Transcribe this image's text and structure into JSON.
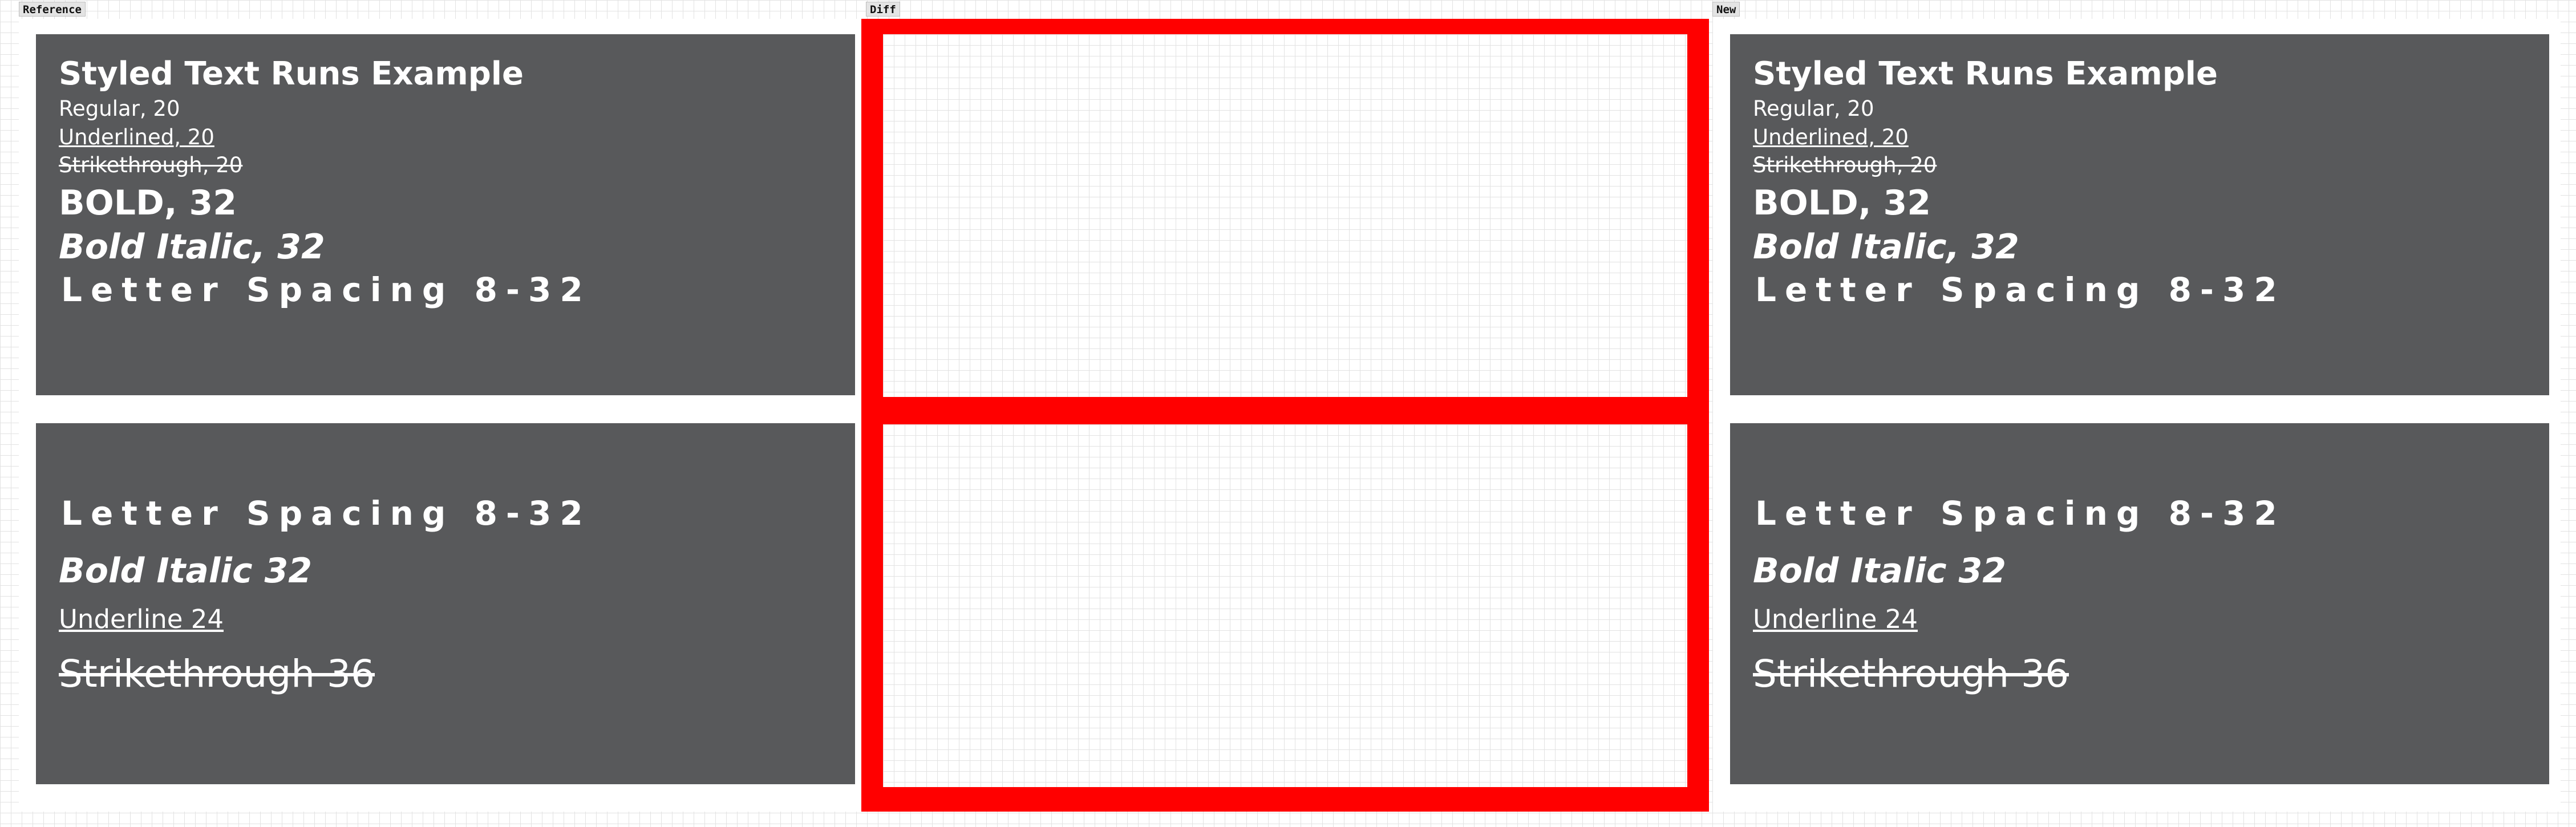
{
  "labels": {
    "reference": "Reference",
    "diff": "Diff",
    "new": "New"
  },
  "panel_top": {
    "title": "Styled Text Runs Example",
    "regular": "Regular, 20",
    "underlined": "Underlined, 20",
    "strikethrough": "Strikethrough, 20",
    "bold": "BOLD, 32",
    "bold_italic": "Bold Italic, 32",
    "letter_spacing": "Letter Spacing 8-32"
  },
  "panel_bottom": {
    "letter_spacing": "Letter Spacing 8-32",
    "bold_italic": "Bold Italic 32",
    "underline": "Underline 24",
    "strikethrough": "Strikethrough 36"
  },
  "colors": {
    "panel_background": "#58595b",
    "diff_highlight": "#ff0000",
    "text": "#ffffff"
  }
}
